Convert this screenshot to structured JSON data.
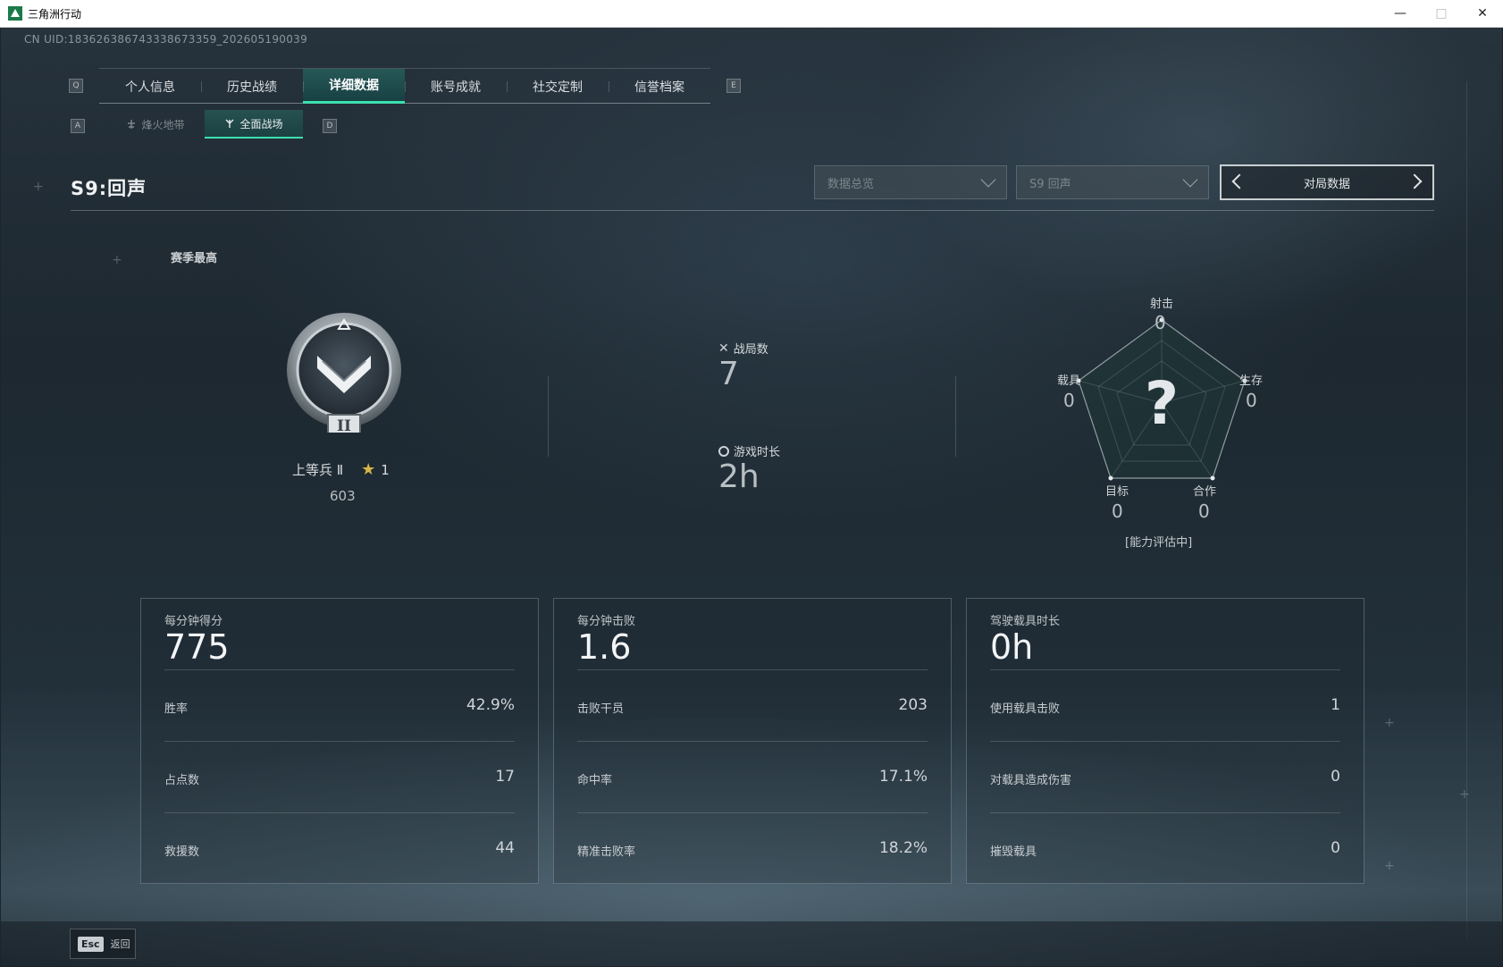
{
  "window": {
    "title": "三角洲行动"
  },
  "header": {
    "uid": "CN UID:183626386743338673359_202605190039"
  },
  "keys": {
    "prev_tab": "Q",
    "next_tab": "E",
    "prev_sub": "A",
    "next_sub": "D"
  },
  "tabs": [
    {
      "label": "个人信息",
      "active": false
    },
    {
      "label": "历史战绩",
      "active": false
    },
    {
      "label": "详细数据",
      "active": true
    },
    {
      "label": "账号成就",
      "active": false
    },
    {
      "label": "社交定制",
      "active": false
    },
    {
      "label": "信誉档案",
      "active": false
    }
  ],
  "subtabs": [
    {
      "label": "烽火地带",
      "icon": "extraction-icon",
      "active": false
    },
    {
      "label": "全面战场",
      "icon": "battlefield-icon",
      "active": true
    }
  ],
  "season": {
    "title": "S9:回声",
    "filters": {
      "overview": "数据总览",
      "season": "S9 回声",
      "switcher": "对局数据"
    }
  },
  "rank": {
    "section_label": "赛季最高",
    "badge_numeral": "II",
    "name": "上等兵 Ⅱ",
    "stars": "1",
    "score": "603"
  },
  "summary": {
    "matches_label": "战局数",
    "matches": "7",
    "playtime_label": "游戏时长",
    "playtime": "2h"
  },
  "radar": {
    "center": "?",
    "axes": [
      {
        "label": "射击",
        "value": "0"
      },
      {
        "label": "生存",
        "value": "0"
      },
      {
        "label": "合作",
        "value": "0"
      },
      {
        "label": "目标",
        "value": "0"
      },
      {
        "label": "载具",
        "value": "0"
      }
    ],
    "note": "[能力评估中]"
  },
  "cards": [
    {
      "title": "每分钟得分",
      "main": "775",
      "rows": [
        {
          "label": "胜率",
          "value": "42.9%"
        },
        {
          "label": "占点数",
          "value": "17"
        },
        {
          "label": "救援数",
          "value": "44"
        }
      ]
    },
    {
      "title": "每分钟击败",
      "main": "1.6",
      "rows": [
        {
          "label": "击败干员",
          "value": "203"
        },
        {
          "label": "命中率",
          "value": "17.1%"
        },
        {
          "label": "精准击败率",
          "value": "18.2%"
        }
      ]
    },
    {
      "title": "驾驶载具时长",
      "main": "0h",
      "rows": [
        {
          "label": "使用载具击败",
          "value": "1"
        },
        {
          "label": "对载具造成伤害",
          "value": "0"
        },
        {
          "label": "摧毁载具",
          "value": "0"
        }
      ]
    }
  ],
  "footer": {
    "esc_key": "Esc",
    "back_label": "返回"
  },
  "colors": {
    "accent": "#3ee0b0",
    "star": "#d7b64a"
  }
}
